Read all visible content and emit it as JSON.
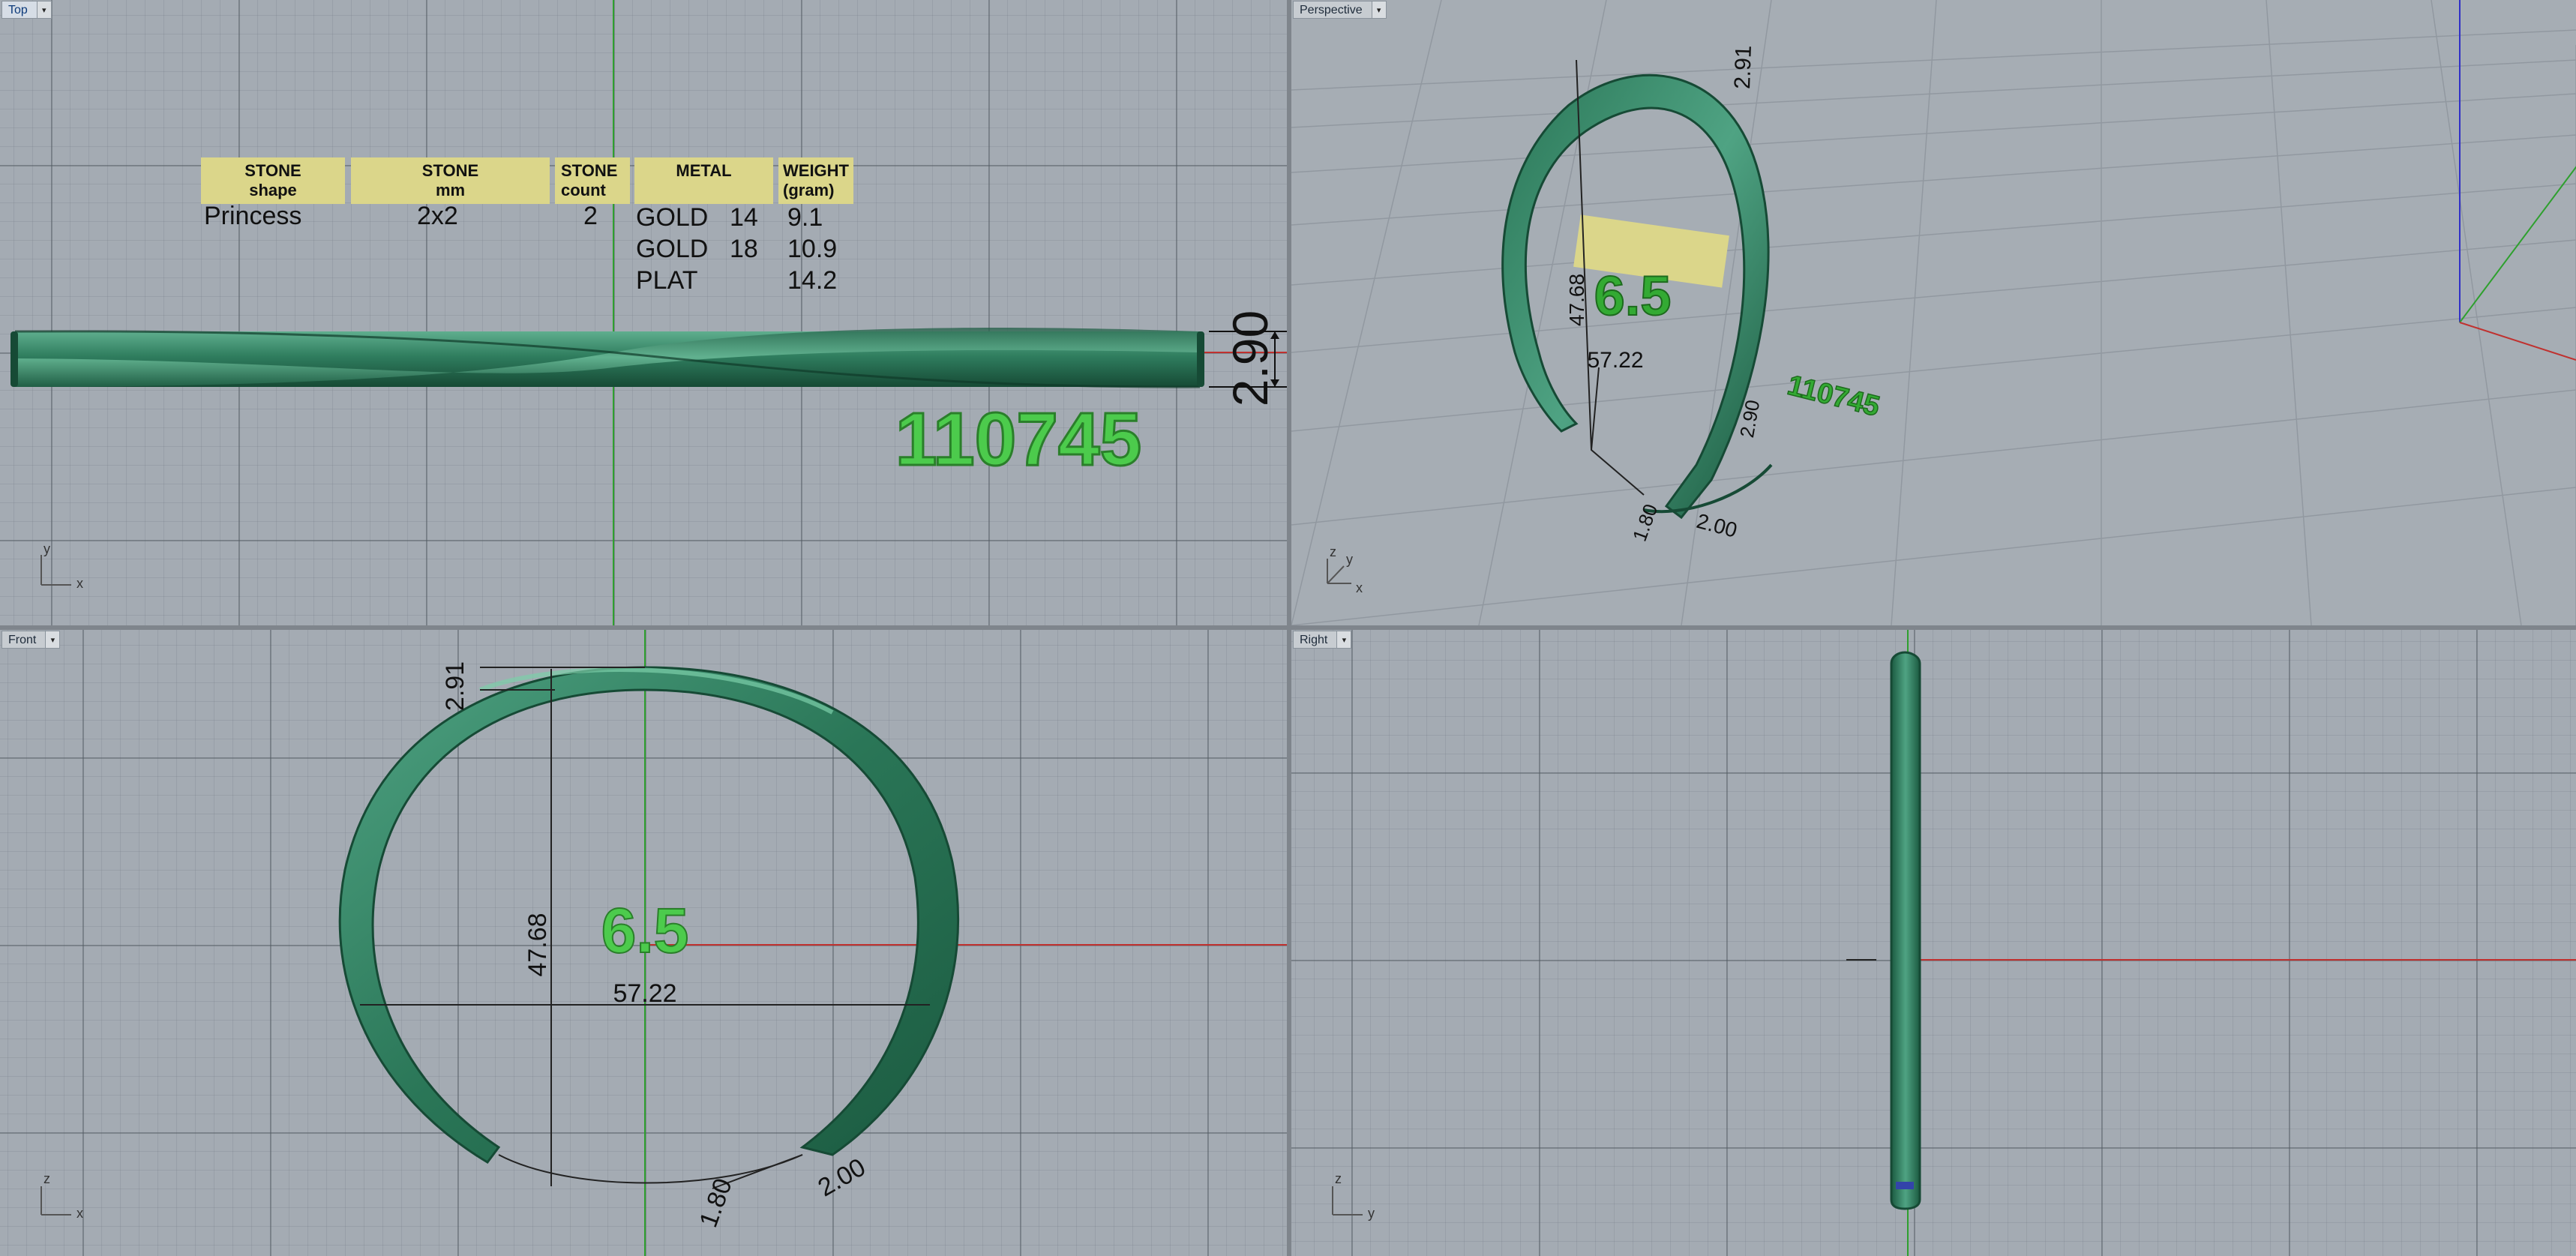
{
  "viewports": {
    "top": {
      "title": "Top",
      "axis_primary": "y",
      "axis_secondary": "x"
    },
    "perspective": {
      "title": "Perspective",
      "axis_z": "z",
      "axis_y": "y",
      "axis_x": "x"
    },
    "front": {
      "title": "Front",
      "axis_primary": "z",
      "axis_secondary": "x"
    },
    "right": {
      "title": "Right",
      "axis_primary": "z",
      "axis_secondary": "y"
    }
  },
  "stone_table": {
    "headers": [
      {
        "line1": "STONE",
        "line2": "shape"
      },
      {
        "line1": "STONE",
        "line2": "mm"
      },
      {
        "line1": "STONE",
        "line2": "count"
      },
      {
        "line1": "METAL",
        "line2": ""
      },
      {
        "line1": "WEIGHT",
        "line2": "(gram)"
      }
    ],
    "row": {
      "shape": "Princess",
      "mm": "2x2",
      "count": "2"
    },
    "metals": [
      {
        "metal": "GOLD",
        "karat": "14",
        "weight": "9.1"
      },
      {
        "metal": "GOLD",
        "karat": "18",
        "weight": "10.9"
      },
      {
        "metal": "PLAT",
        "karat": "",
        "weight": "14.2"
      }
    ]
  },
  "model_number": "110745",
  "ring_size": "6.5",
  "dimensions": {
    "width": "2.90",
    "thickness": "2.91",
    "height": "47.68",
    "inner_width": "57.22",
    "gap_a": "1.80",
    "gap_b": "2.00"
  },
  "colors": {
    "viewport_bg": "#a4abb3",
    "band": "#2f7d5e",
    "label_green": "#4ccb4c",
    "table_header": "#dbd68a",
    "axis_x": "#c0312f",
    "axis_y": "#2ea02e",
    "axis_z": "#3030c8"
  }
}
